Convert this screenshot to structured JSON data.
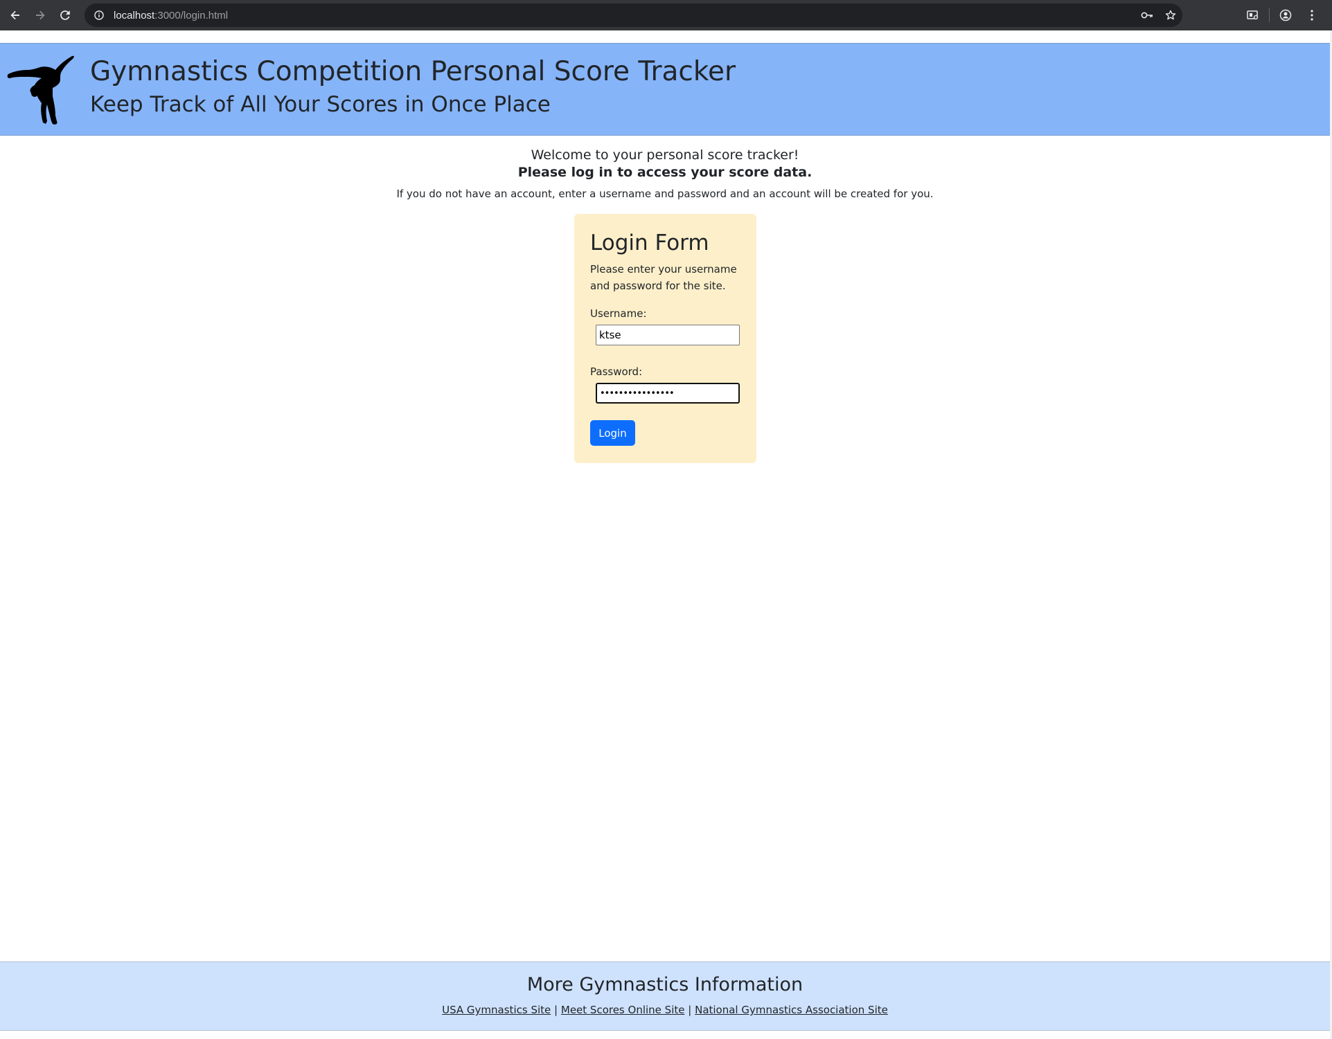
{
  "browser": {
    "url_host": "localhost",
    "url_path": ":3000/login.html"
  },
  "header": {
    "title": "Gymnastics Competition Personal Score Tracker",
    "subtitle": "Keep Track of All Your Scores in Once Place",
    "logo_icon": "gymnast-silhouette-icon"
  },
  "intro": {
    "welcome": "Welcome to your personal score tracker!",
    "prompt": "Please log in to access your score data.",
    "note": "If you do not have an account, enter a username and password and an account will be created for you."
  },
  "login_form": {
    "title": "Login Form",
    "description": "Please enter your username and password for the site.",
    "username_label": "Username:",
    "username_value": "ktse",
    "password_label": "Password:",
    "password_value": "••••••••••••••••",
    "button_label": "Login"
  },
  "footer": {
    "title": "More Gymnastics Information",
    "separator": "|",
    "links": [
      "USA Gymnastics Site",
      "Meet Scores Online Site",
      "National Gymnastics Association Site"
    ]
  },
  "colors": {
    "header_bg": "#86b4f8",
    "card_bg": "#fdefc9",
    "button_bg": "#0d6efd",
    "footer_bg": "#cfe2fd"
  }
}
